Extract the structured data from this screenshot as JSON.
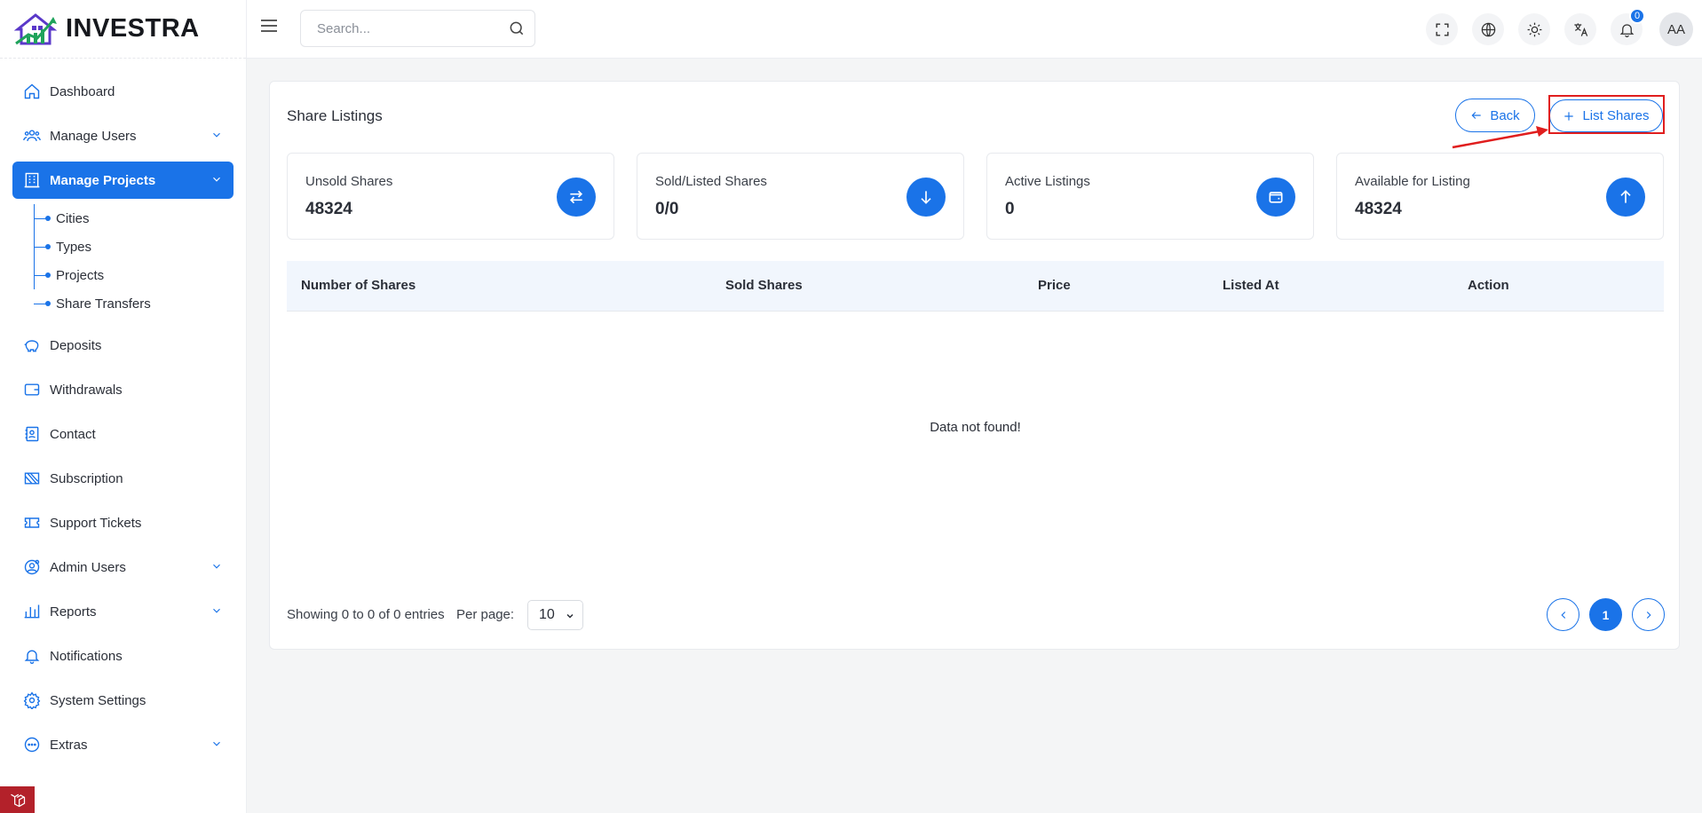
{
  "brand": {
    "name": "INVESTRA"
  },
  "colors": {
    "accent": "#1a73e8",
    "highlight": "#e01e1e"
  },
  "sidebar": {
    "items": [
      {
        "label": "Dashboard",
        "icon": "home-icon"
      },
      {
        "label": "Manage Users",
        "icon": "users-icon",
        "expandable": true
      },
      {
        "label": "Manage Projects",
        "icon": "building-icon",
        "expandable": true,
        "active": true
      },
      {
        "label": "Deposits",
        "icon": "piggy-bank-icon"
      },
      {
        "label": "Withdrawals",
        "icon": "wallet-icon"
      },
      {
        "label": "Contact",
        "icon": "contact-book-icon"
      },
      {
        "label": "Subscription",
        "icon": "subscription-icon"
      },
      {
        "label": "Support Tickets",
        "icon": "ticket-icon"
      },
      {
        "label": "Admin Users",
        "icon": "admin-user-icon",
        "expandable": true
      },
      {
        "label": "Reports",
        "icon": "bar-chart-icon",
        "expandable": true
      },
      {
        "label": "Notifications",
        "icon": "bell-icon"
      },
      {
        "label": "System Settings",
        "icon": "gear-icon"
      },
      {
        "label": "Extras",
        "icon": "more-circle-icon",
        "expandable": true
      }
    ],
    "sub_items": [
      "Cities",
      "Types",
      "Projects",
      "Share Transfers"
    ]
  },
  "topbar": {
    "search_placeholder": "Search...",
    "notification_count": "0",
    "avatar_initials": "AA"
  },
  "page": {
    "title": "Share Listings",
    "back_label": "Back",
    "list_shares_label": "List Shares"
  },
  "stats": [
    {
      "label": "Unsold Shares",
      "value": "48324",
      "icon": "swap-icon"
    },
    {
      "label": "Sold/Listed Shares",
      "value": "0/0",
      "icon": "arrow-down-icon"
    },
    {
      "label": "Active Listings",
      "value": "0",
      "icon": "wallet-icon"
    },
    {
      "label": "Available for Listing",
      "value": "48324",
      "icon": "arrow-up-icon"
    }
  ],
  "table": {
    "columns": [
      "Number of Shares",
      "Sold Shares",
      "Price",
      "Listed At",
      "Action"
    ],
    "empty_text": "Data not found!"
  },
  "pagination": {
    "info": "Showing 0 to 0 of 0 entries",
    "per_page_label": "Per page:",
    "per_page_value": "10",
    "current_page": "1"
  }
}
